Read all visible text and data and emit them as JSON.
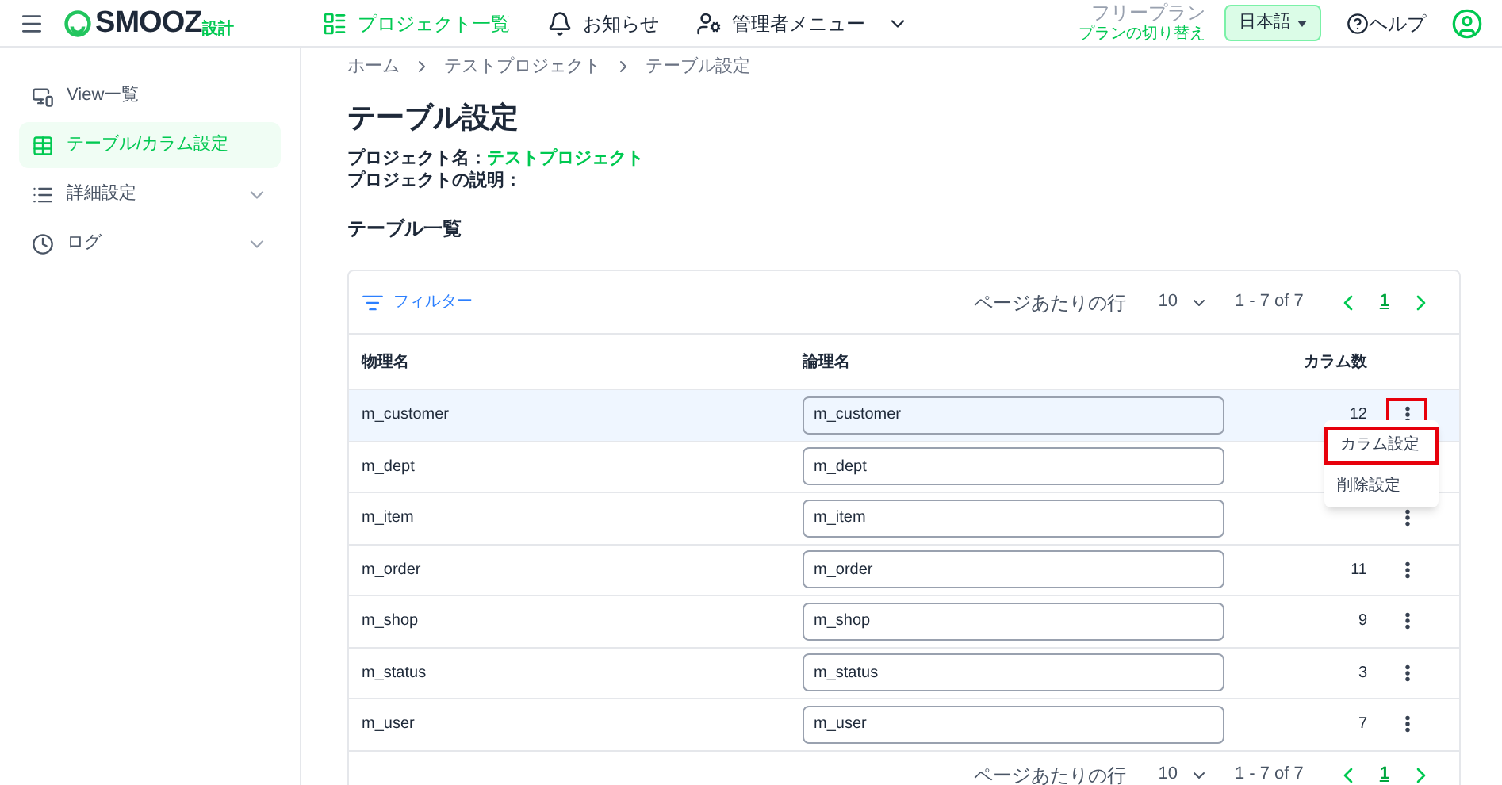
{
  "header": {
    "logo_text": "SMOOZ",
    "logo_suffix": "設計",
    "nav": [
      {
        "label": "プロジェクト一覧",
        "kind": "list",
        "selected": true
      },
      {
        "label": "お知らせ",
        "kind": "bell",
        "selected": false
      },
      {
        "label": "管理者メニュー",
        "kind": "admin",
        "selected": false
      }
    ],
    "plan": "フリープラン",
    "plan_link": "プランの切り替え",
    "language": "日本語",
    "help": "ヘルプ"
  },
  "sidebar": {
    "items": [
      {
        "label": "View一覧",
        "kind": "view",
        "selected": false,
        "expandable": false
      },
      {
        "label": "テーブル/カラム設定",
        "kind": "table",
        "selected": true,
        "expandable": false
      },
      {
        "label": "詳細設定",
        "kind": "list",
        "selected": false,
        "expandable": true
      },
      {
        "label": "ログ",
        "kind": "clock",
        "selected": false,
        "expandable": true
      }
    ]
  },
  "breadcrumb": [
    "ホーム",
    "テストプロジェクト",
    "テーブル設定"
  ],
  "page_title": "テーブル設定",
  "project_name_label": "プロジェクト名：",
  "project_name": "テストプロジェクト",
  "project_description_label": "プロジェクトの説明：",
  "section_title": "テーブル一覧",
  "table": {
    "filter": "フィルター",
    "pagination_top": {
      "rows_per_page_label": "ページあたりの行",
      "rows_per_page": "10",
      "range": "1 - 7 of 7",
      "page": "1"
    },
    "pagination_bottom": {
      "rows_per_page_label": "ページあたりの行",
      "rows_per_page": "10",
      "range": "1 - 7 of 7",
      "page": "1"
    },
    "columns": [
      "物理名",
      "論理名",
      "カラム数"
    ],
    "rows": [
      {
        "physical": "m_customer",
        "logical": "m_customer",
        "count": "12",
        "selected": true,
        "menu_highlighted": true
      },
      {
        "physical": "m_dept",
        "logical": "m_dept",
        "selected": false
      },
      {
        "physical": "m_item",
        "logical": "m_item",
        "selected": false,
        "menu_highlighted": false
      },
      {
        "physical": "m_order",
        "logical": "m_order",
        "count": "11",
        "selected": false,
        "menu_highlighted": false
      },
      {
        "physical": "m_shop",
        "logical": "m_shop",
        "count": "9",
        "selected": false,
        "menu_highlighted": false
      },
      {
        "physical": "m_status",
        "logical": "m_status",
        "count": "3",
        "selected": false,
        "menu_highlighted": false
      },
      {
        "physical": "m_user",
        "logical": "m_user",
        "count": "7",
        "selected": false,
        "menu_highlighted": false
      }
    ],
    "row_menu": {
      "items": [
        {
          "label": "カラム設定",
          "highlighted": true
        },
        {
          "label": "削除設定",
          "highlighted": false
        }
      ]
    }
  }
}
